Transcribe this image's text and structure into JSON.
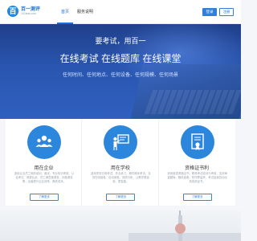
{
  "header": {
    "logo_mark": "百",
    "logo_name": "百一测评",
    "logo_sub": "101test.com",
    "nav": [
      {
        "label": "首页"
      },
      {
        "label": "服务说明"
      }
    ],
    "login_label": "登录",
    "register_label": "注册"
  },
  "hero": {
    "title": "要考试，用百一",
    "subtitle": "在线考试  在线题库  在线课堂",
    "tags": "任何时间、任何地点、任何设备、任何规模、任何场景"
  },
  "cards": [
    {
      "title": "用在企业",
      "desc": "适用企业员工岗前培训、面试、专业知识考核、认证考试、竞赛比武、员工满意度调查、问卷调查等，全面提升企业效率、降低成本。",
      "button": "了解更多",
      "icon": "people-icon"
    },
    {
      "title": "用在学校",
      "desc": "适用学校日常考试、作业练习、期中期末考试，支持在线组卷、自动阅卷、成绩分析，让教学更高效、更智能。",
      "button": "了解更多",
      "icon": "teacher-icon"
    },
    {
      "title": "资格证书利",
      "desc": "适用各类资格证书、职称考试培训与考核，支持海量题库、随机组卷、防作弊监考，考试结束自动出具成绩证书。",
      "button": "了解更多",
      "icon": "certificate-icon"
    }
  ],
  "colors": {
    "accent": "#2b86dc",
    "hero_top": "#1f3f8a",
    "hero_bottom": "#2f5fbf"
  }
}
